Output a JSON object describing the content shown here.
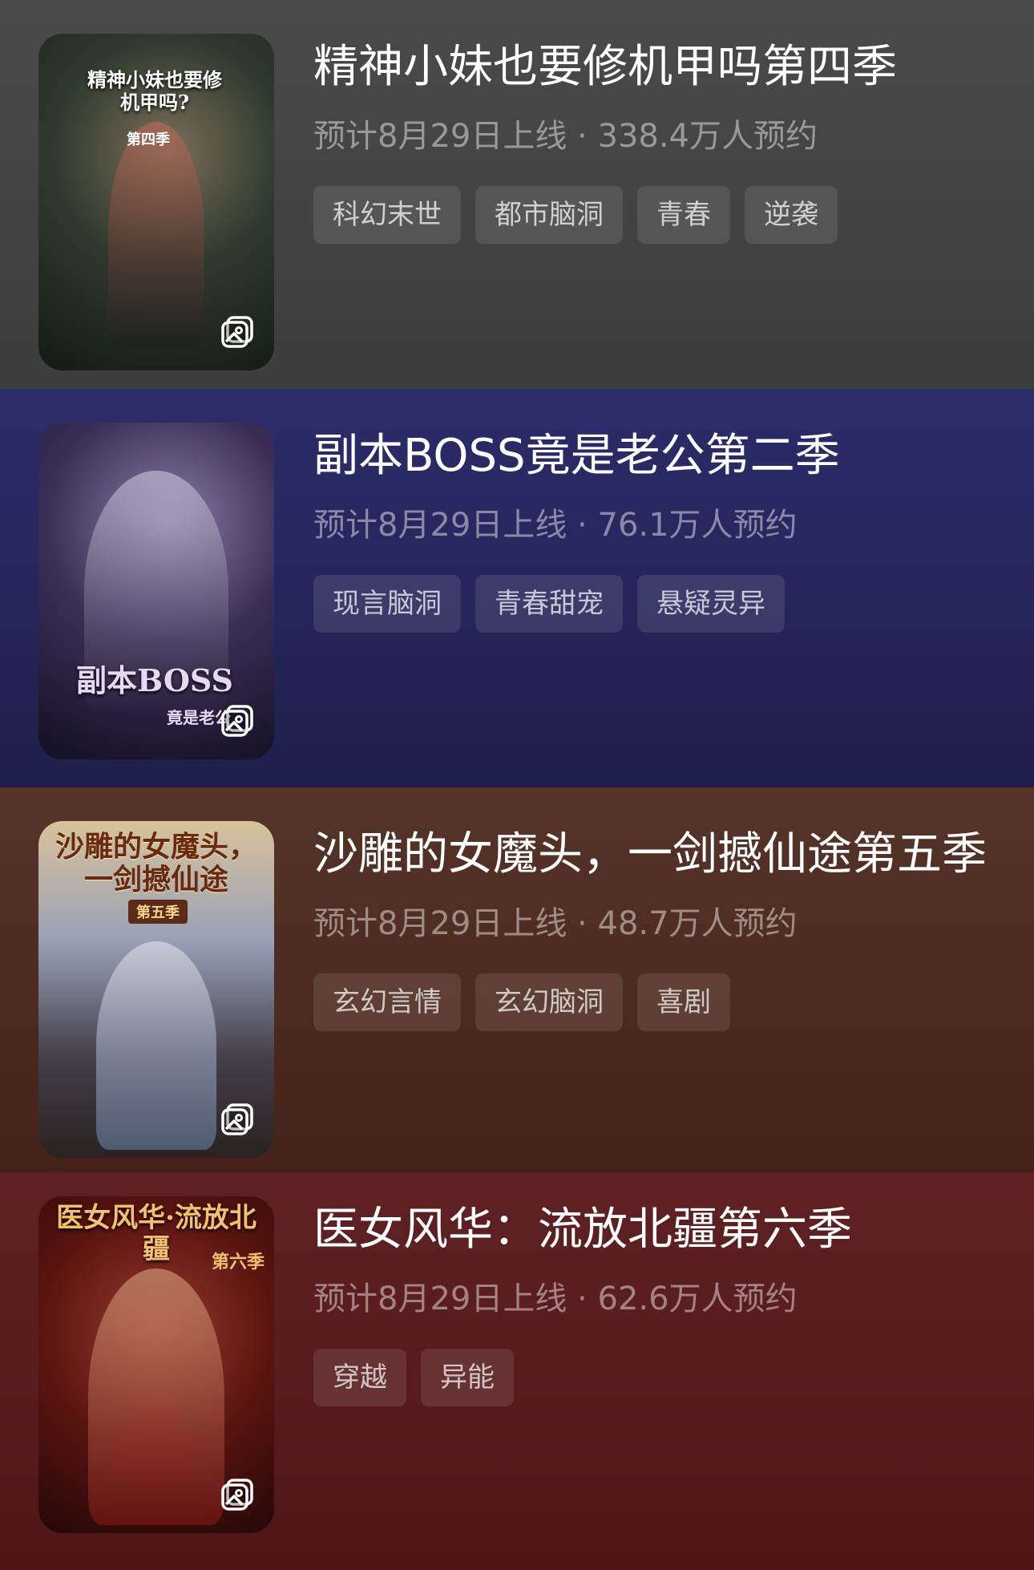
{
  "items": [
    {
      "title": "精神小妹也要修机甲吗第四季",
      "meta": "预计8月29日上线 · 338.4万人预约",
      "tags": [
        "科幻末世",
        "都市脑洞",
        "青春",
        "逆袭"
      ],
      "cover_title": "精神小妹也要修机甲吗?",
      "cover_sub": "第四季"
    },
    {
      "title": "副本BOSS竟是老公第二季",
      "meta": "预计8月29日上线 · 76.1万人预约",
      "tags": [
        "现言脑洞",
        "青春甜宠",
        "悬疑灵异"
      ],
      "cover_title": "副本BOSS",
      "cover_sub": "竟是老公"
    },
    {
      "title": "沙雕的女魔头，一剑撼仙途第五季",
      "meta": "预计8月29日上线 · 48.7万人预约",
      "tags": [
        "玄幻言情",
        "玄幻脑洞",
        "喜剧"
      ],
      "cover_title": "沙雕的女魔头，一剑撼仙途",
      "cover_sub": "第五季"
    },
    {
      "title": "医女风华：流放北疆第六季",
      "meta": "预计8月29日上线 · 62.6万人预约",
      "tags": [
        "穿越",
        "异能"
      ],
      "cover_title": "医女风华·流放北疆",
      "cover_sub": "第六季"
    }
  ],
  "icons": {
    "gallery": "gallery-icon"
  },
  "colors": {
    "card_1_bg": "#444444",
    "card_2_bg": "#25265c",
    "card_3_bg": "#4d2b21",
    "card_4_bg": "#571b1e",
    "title": "#ffffff",
    "meta": "rgba(255,255,255,0.45)",
    "tag_bg": "rgba(255,255,255,0.1)"
  }
}
